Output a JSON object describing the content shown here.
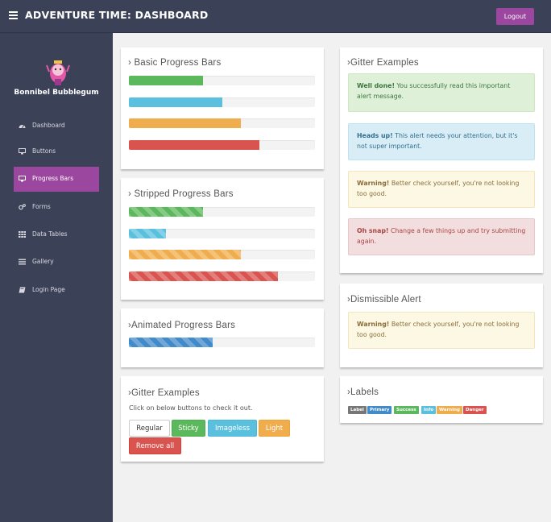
{
  "header": {
    "title": "ADVENTURE TIME: DASHBOARD",
    "logout_label": "Logout"
  },
  "sidebar": {
    "user_name": "Bonnibel Bubblegum",
    "items": [
      {
        "label": "Dashboard",
        "icon": "dashboard-icon",
        "active": false
      },
      {
        "label": "Buttons",
        "icon": "desktop-icon",
        "active": false
      },
      {
        "label": "Progress Bars",
        "icon": "desktop-icon",
        "active": true
      },
      {
        "label": "Forms",
        "icon": "cogs-icon",
        "active": false
      },
      {
        "label": "Data Tables",
        "icon": "grid-icon",
        "active": false
      },
      {
        "label": "Gallery",
        "icon": "list-icon",
        "active": false
      },
      {
        "label": "Login Page",
        "icon": "book-icon",
        "active": false
      }
    ]
  },
  "basic_progress": {
    "title": "Basic Progress Bars",
    "bars": [
      {
        "percent": 40,
        "color": "#5cb85c"
      },
      {
        "percent": 50,
        "color": "#5bc0de"
      },
      {
        "percent": 60,
        "color": "#f0ad4e"
      },
      {
        "percent": 70,
        "color": "#d9534f"
      }
    ]
  },
  "striped_progress": {
    "title": "Stripped Progress Bars",
    "bars": [
      {
        "percent": 40,
        "color": "#5cb85c"
      },
      {
        "percent": 20,
        "color": "#5bc0de"
      },
      {
        "percent": 60,
        "color": "#f0ad4e"
      },
      {
        "percent": 80,
        "color": "#d9534f"
      }
    ]
  },
  "animated_progress": {
    "title": "Animated Progress Bars",
    "bars": [
      {
        "percent": 45,
        "color": "#428bca"
      }
    ]
  },
  "gitter_buttons": {
    "title": "Gitter Examples",
    "hint": "Click on below buttons to check it out.",
    "regular": "Regular",
    "sticky": "Sticky",
    "imageless": "Imageless",
    "light": "Light",
    "remove_all": "Remove all"
  },
  "gitter_alerts": {
    "title": "Gitter Examples",
    "alerts": [
      {
        "strong": "Well done!",
        "text": " You successfully read this important alert message."
      },
      {
        "strong": "Heads up!",
        "text": " This alert needs your attention, but it's not super important."
      },
      {
        "strong": "Warning!",
        "text": " Better check yourself, you're not looking too good."
      },
      {
        "strong": "Oh snap!",
        "text": " Change a few things up and try submitting again."
      }
    ]
  },
  "dismissible": {
    "title": "Dismissible Alert",
    "strong": "Warning!",
    "text": " Better check yourself, you're not looking too good."
  },
  "labels": {
    "title": "Labels",
    "items": [
      "Label",
      "Primary",
      "Success",
      "Info",
      "Warning",
      "Danger"
    ]
  }
}
